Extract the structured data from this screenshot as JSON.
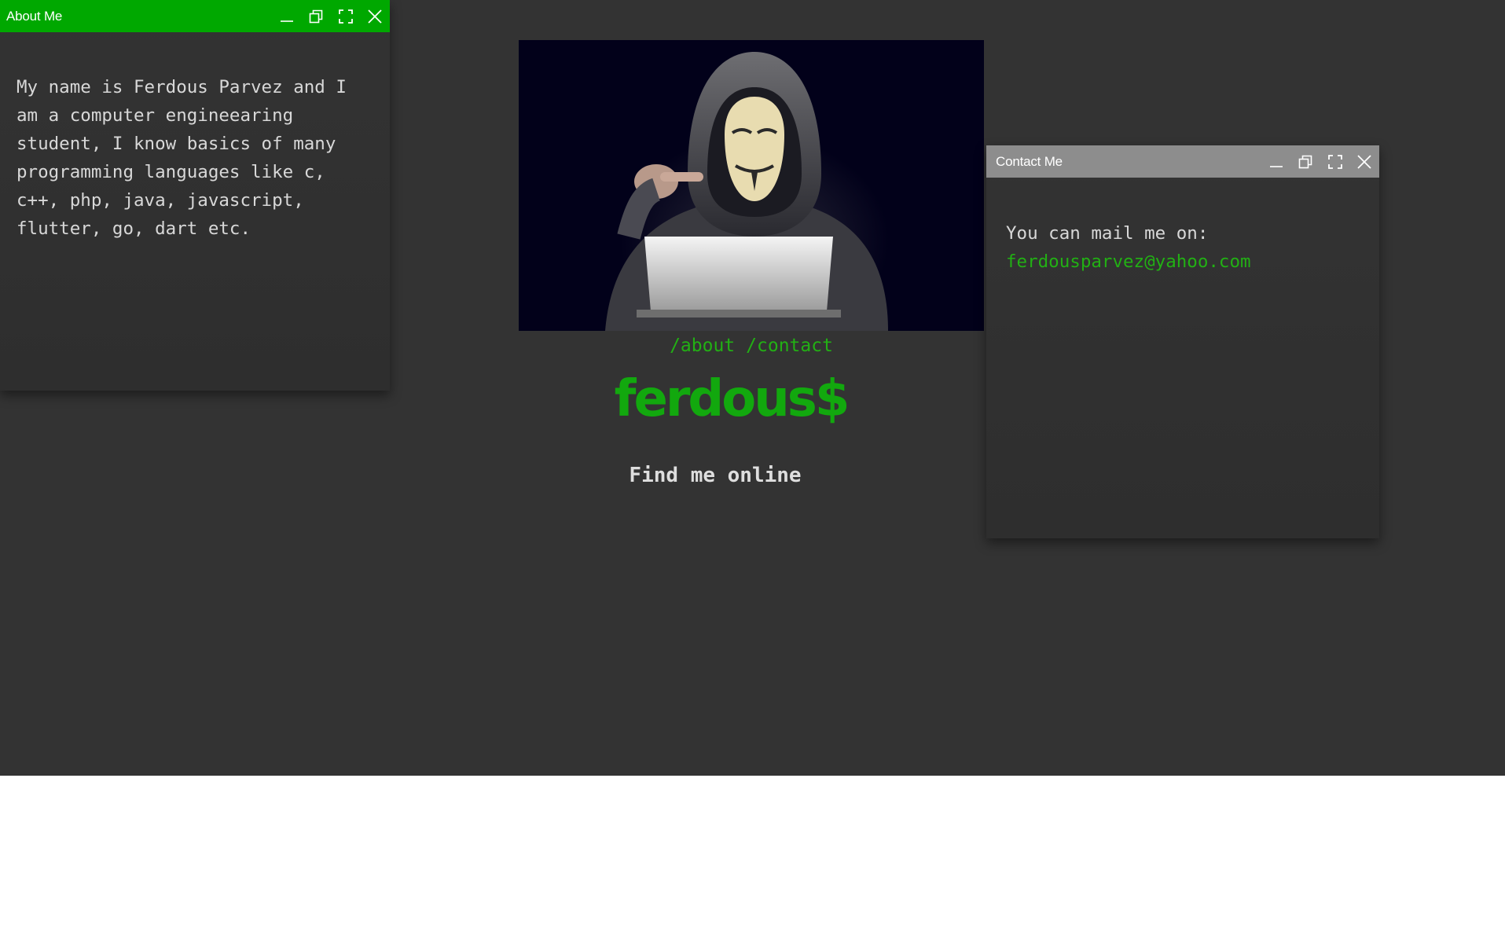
{
  "about_window": {
    "title": "About Me",
    "text": "My name is Ferdous Parvez and I am a computer engineearing student, I know basics of many programming languages like c, c++, php, java, javascript, flutter, go, dart etc.",
    "titlebar_color": "#00a800"
  },
  "contact_window": {
    "title": "Contact Me",
    "text": "You can mail me on:",
    "email": "ferdousparvez@yahoo.com",
    "titlebar_color": "#8d8d8d"
  },
  "window_controls": [
    "minimize-icon",
    "restore-icon",
    "maximize-icon",
    "close-icon"
  ],
  "nav": {
    "about": "/about",
    "contact": "/contact"
  },
  "logo": "ferdous$",
  "find_online": "Find me online",
  "colors": {
    "accent_green": "#22b014",
    "background": "#333333"
  }
}
